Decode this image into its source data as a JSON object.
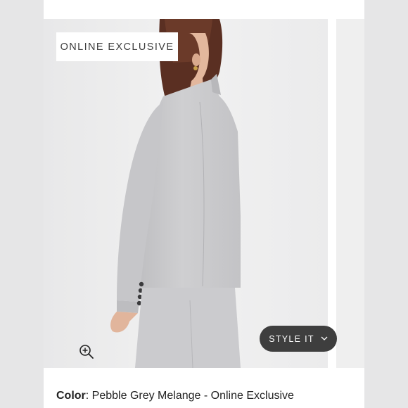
{
  "badge": {
    "text": "ONLINE EXCLUSIVE"
  },
  "style_it": {
    "label": "STYLE IT",
    "icon": "chevron-down-icon"
  },
  "zoom": {
    "icon": "zoom-in-icon"
  },
  "product": {
    "color_label": "Color",
    "color_value": "Pebble Grey Melange - Online Exclusive"
  },
  "colors": {
    "badge_bg": "#ffffff",
    "button_bg": "#3e3e3e",
    "jacket": "#c9c9cb"
  }
}
